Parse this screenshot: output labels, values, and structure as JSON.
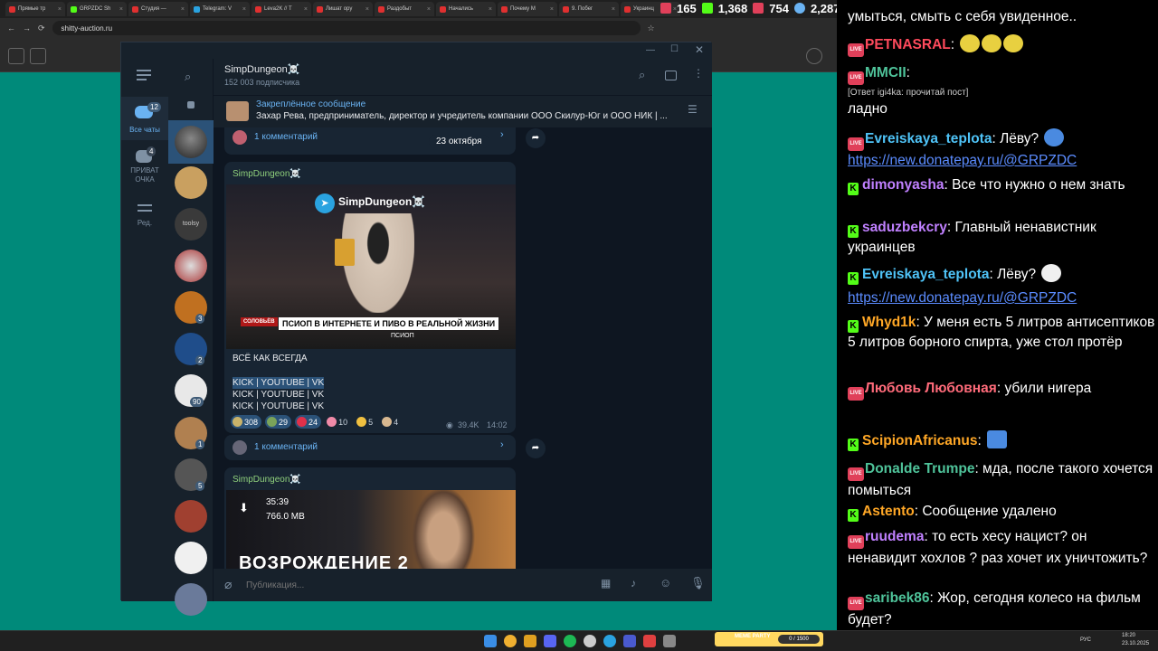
{
  "browser": {
    "tabs": [
      "Прямые тр",
      "GRPZDC Sh",
      "Студия — ",
      "Telegram: V",
      "Leva2K // Т",
      "Лишат ору",
      "Раздобыт",
      "Начались",
      "Почему М",
      "9. Побег",
      "Украинц"
    ],
    "url": "shitty-auction.ru"
  },
  "stats": {
    "viewers": "165",
    "kick": "1,368",
    "live": "754",
    "users": "2,287"
  },
  "telegram": {
    "channel_name": "SimpDungeon☠️",
    "subscribers": "152 003 подписчика",
    "nav": {
      "all_chats": "Все чаты",
      "all_badge": "12",
      "private": "ПРИВАТ\nОЧКА",
      "private_badge": "4",
      "edit": "Ред."
    },
    "chat_badges": [
      "3",
      "2",
      "90",
      "1",
      "5"
    ],
    "pinned_title": "Закреплённое сообщение",
    "pinned_text": "Захар Рева, предприниматель, директор и учредитель компании ООО Скилур-Юг и ООО НИК | ...",
    "prev_comments": "1 комментарий",
    "date_badge": "23 октября",
    "post1": {
      "author": "SimpDungeon☠️",
      "video_channel": "SimpDungeon☠️",
      "video_caption": "ПСИОП В ИНТЕРНЕТЕ И ПИВО В РЕАЛЬНОЙ ЖИЗНИ",
      "video_sub": "ПСИОП",
      "video_logo": "СОЛОВЬЁВ",
      "text": "ВСЁ КАК ВСЕГДА",
      "links": [
        "KICK | YOUTUBE | VK",
        "KICK | YOUTUBE | VK",
        "KICK | YOUTUBE | VK"
      ],
      "reactions": [
        {
          "count": "308",
          "color": "#c9b36a"
        },
        {
          "count": "29",
          "color": "#7aa35a"
        },
        {
          "count": "24",
          "color": "#e0304a"
        },
        {
          "count": "10",
          "color": "#f08aa8"
        },
        {
          "count": "5",
          "color": "#f0c040"
        },
        {
          "count": "4",
          "color": "#d8b890"
        }
      ],
      "views": "39.4K",
      "time": "14:02",
      "comments": "1 комментарий"
    },
    "post2": {
      "author": "SimpDungeon☠️",
      "duration": "35:39",
      "size": "766.0 MB",
      "title": "ВОЗРОЖДЕНИЕ 2"
    },
    "input_placeholder": "Публикация..."
  },
  "chat": [
    {
      "type": "text",
      "text": "умыться, смыть с себя увиденное.."
    },
    {
      "type": "msg",
      "badge": "live",
      "nick": "PETNASRAL",
      "color": "#ff4a5c",
      "text": ":"
    },
    {
      "type": "msg",
      "badge": "live",
      "nick": "MMCII",
      "color": "#4fc39a",
      "text": ":"
    },
    {
      "type": "reply",
      "text": "[Ответ igi4ka: прочитай пост]"
    },
    {
      "type": "text",
      "text": "ладно"
    },
    {
      "type": "msg",
      "badge": "live",
      "nick": "Evreiskaya_teplota",
      "color": "#4fc3f7",
      "text": ": Лёву?"
    },
    {
      "type": "link",
      "text": "https://new.donatepay.ru/@GRPZDC"
    },
    {
      "type": "msg",
      "badge": "kick",
      "nick": "dimonyasha",
      "color": "#c080ff",
      "text": ": Все что нужно о нем знать"
    },
    {
      "type": "msg",
      "badge": "kick",
      "nick": "saduzbekcry",
      "color": "#c080ff",
      "text": ": Главный ненавистник украинцев"
    },
    {
      "type": "msg",
      "badge": "kick",
      "nick": "Evreiskaya_teplota",
      "color": "#4fc3f7",
      "text": ": Лёву?"
    },
    {
      "type": "link",
      "text": "https://new.donatepay.ru/@GRPZDC"
    },
    {
      "type": "msg",
      "badge": "kick",
      "nick": "Whyd1k",
      "color": "#ffa726",
      "text": ": У меня есть 5 литров антисептиков 5 литров борного спирта, уже стол протёр"
    },
    {
      "type": "msg",
      "badge": "live",
      "nick": "Любовь Любовная",
      "color": "#ff6b7a",
      "text": ": убили нигера"
    },
    {
      "type": "msg",
      "badge": "kick",
      "nick": "ScipionAfricanus",
      "color": "#ffa726",
      "text": ":"
    },
    {
      "type": "msg",
      "badge": "live",
      "nick": "Donalde Trumpe",
      "color": "#4fc39a",
      "text": ": мда, после такого хочется помыться"
    },
    {
      "type": "msg",
      "badge": "kick",
      "nick": "Astento",
      "color": "#ffa726",
      "text": ": Сообщение удалено"
    },
    {
      "type": "msg",
      "badge": "live",
      "nick": "ruudema",
      "color": "#c080ff",
      "text": ": то есть хесу нацист? он ненавидит хохлов ? раз хочет их уничтожить?"
    },
    {
      "type": "msg",
      "badge": "live",
      "nick": "saribek86",
      "color": "#4fc39a",
      "text": ": Жор, сегодня колесо на фильм будет?"
    }
  ],
  "taskbar": {
    "meme_party": "MEME PARTY",
    "meme_count": "0 / 1500",
    "lang": "РУС",
    "time": "18:20",
    "date": "23.10.2025"
  },
  "colors": {
    "telegram_bg": "#0e1621",
    "telegram_panel": "#17212b",
    "accent": "#6ab3f3",
    "page_bg": "#008a7a"
  }
}
